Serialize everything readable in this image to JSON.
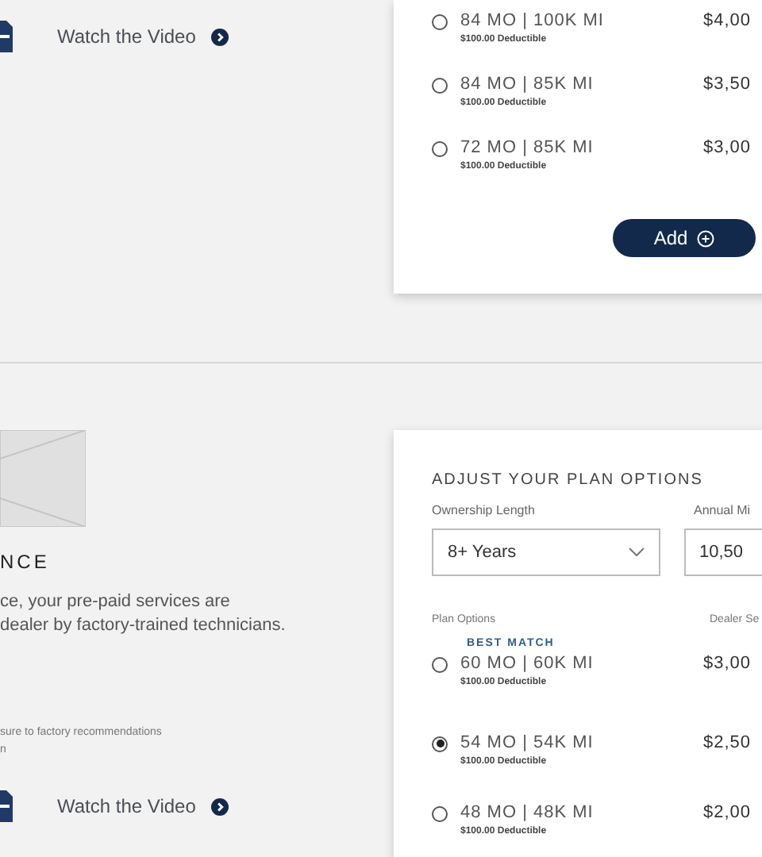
{
  "top": {
    "video_link": "Watch the Video",
    "plans": [
      {
        "label": "84 MO | 100K MI",
        "deductible": "$100.00 Deductible",
        "price": "$4,00",
        "selected": false
      },
      {
        "label": "84 MO | 85K MI",
        "deductible": "$100.00 Deductible",
        "price": "$3,50",
        "selected": false
      },
      {
        "label": "72 MO | 85K MI",
        "deductible": "$100.00 Deductible",
        "price": "$3,00",
        "selected": false
      }
    ],
    "add_button": "Add"
  },
  "bottom": {
    "heading": "NCE",
    "description_lines": [
      "ce, your pre-paid services are",
      "dealer by factory-trained technicians."
    ],
    "note_lines": [
      "sure to factory recommendations",
      "n"
    ],
    "video_link": "Watch the Video",
    "options": {
      "title": "ADJUST YOUR PLAN OPTIONS",
      "ownership": {
        "label": "Ownership Length",
        "value": "8+ Years"
      },
      "mileage": {
        "label": "Annual Mi",
        "value": "10,50"
      },
      "plan_options_label": "Plan Options",
      "price_column_label": "Dealer Se",
      "plans": [
        {
          "badge": "BEST MATCH",
          "label": "60 MO | 60K MI",
          "deductible": "$100.00 Deductible",
          "price": "$3,00",
          "selected": false
        },
        {
          "label": "54 MO | 54K MI",
          "deductible": "$100.00 Deductible",
          "price": "$2,50",
          "selected": true
        },
        {
          "label": "48 MO | 48K MI",
          "deductible": "$100.00 Deductible",
          "price": "$2,00",
          "selected": false
        }
      ]
    }
  }
}
